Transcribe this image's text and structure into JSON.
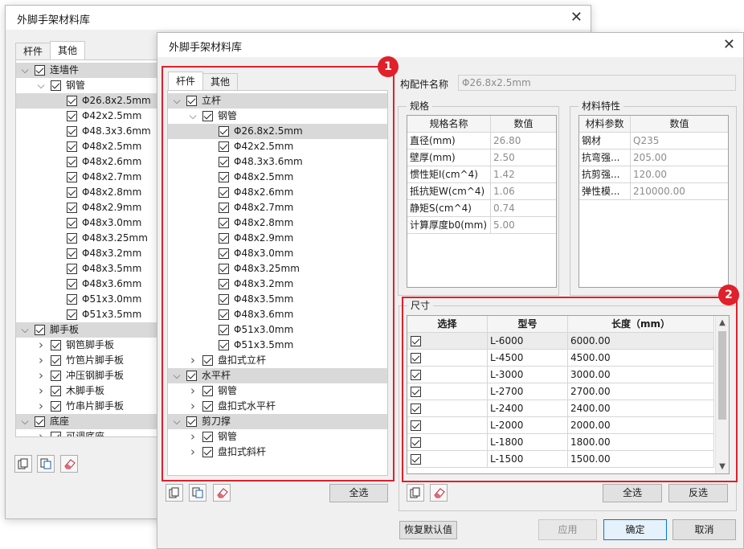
{
  "back_window": {
    "title": "外脚手架材料库",
    "tabs": [
      "杆件",
      "其他"
    ],
    "active_tab": 1,
    "nodes": [
      {
        "level": 0,
        "arrow": "v",
        "label": "连墙件",
        "hl": true
      },
      {
        "level": 1,
        "arrow": "v",
        "label": "钢管",
        "hl": false
      },
      {
        "level": 2,
        "arrow": "",
        "label": "Φ26.8x2.5mm",
        "hl": true
      },
      {
        "level": 2,
        "arrow": "",
        "label": "Φ42x2.5mm",
        "hl": false
      },
      {
        "level": 2,
        "arrow": "",
        "label": "Φ48.3x3.6mm",
        "hl": false
      },
      {
        "level": 2,
        "arrow": "",
        "label": "Φ48x2.5mm",
        "hl": false
      },
      {
        "level": 2,
        "arrow": "",
        "label": "Φ48x2.6mm",
        "hl": false
      },
      {
        "level": 2,
        "arrow": "",
        "label": "Φ48x2.7mm",
        "hl": false
      },
      {
        "level": 2,
        "arrow": "",
        "label": "Φ48x2.8mm",
        "hl": false
      },
      {
        "level": 2,
        "arrow": "",
        "label": "Φ48x2.9mm",
        "hl": false
      },
      {
        "level": 2,
        "arrow": "",
        "label": "Φ48x3.0mm",
        "hl": false
      },
      {
        "level": 2,
        "arrow": "",
        "label": "Φ48x3.25mm",
        "hl": false
      },
      {
        "level": 2,
        "arrow": "",
        "label": "Φ48x3.2mm",
        "hl": false
      },
      {
        "level": 2,
        "arrow": "",
        "label": "Φ48x3.5mm",
        "hl": false
      },
      {
        "level": 2,
        "arrow": "",
        "label": "Φ48x3.6mm",
        "hl": false
      },
      {
        "level": 2,
        "arrow": "",
        "label": "Φ51x3.0mm",
        "hl": false
      },
      {
        "level": 2,
        "arrow": "",
        "label": "Φ51x3.5mm",
        "hl": false
      },
      {
        "level": 0,
        "arrow": "v",
        "label": "脚手板",
        "hl": true
      },
      {
        "level": 1,
        "arrow": ">",
        "label": "钢笆脚手板",
        "hl": false
      },
      {
        "level": 1,
        "arrow": ">",
        "label": "竹笆片脚手板",
        "hl": false
      },
      {
        "level": 1,
        "arrow": ">",
        "label": "冲压钢脚手板",
        "hl": false
      },
      {
        "level": 1,
        "arrow": ">",
        "label": "木脚手板",
        "hl": false
      },
      {
        "level": 1,
        "arrow": ">",
        "label": "竹串片脚手板",
        "hl": false
      },
      {
        "level": 0,
        "arrow": "v",
        "label": "底座",
        "hl": true
      },
      {
        "level": 1,
        "arrow": ">",
        "label": "可调底座",
        "hl": false
      }
    ]
  },
  "front_window": {
    "title": "外脚手架材料库",
    "tabs": [
      "杆件",
      "其他"
    ],
    "active_tab": 0,
    "nodes": [
      {
        "level": 0,
        "arrow": "v",
        "label": "立杆",
        "hl": true
      },
      {
        "level": 1,
        "arrow": "v",
        "label": "钢管",
        "hl": false
      },
      {
        "level": 2,
        "arrow": "",
        "label": "Φ26.8x2.5mm",
        "hl": true
      },
      {
        "level": 2,
        "arrow": "",
        "label": "Φ42x2.5mm",
        "hl": false
      },
      {
        "level": 2,
        "arrow": "",
        "label": "Φ48.3x3.6mm",
        "hl": false
      },
      {
        "level": 2,
        "arrow": "",
        "label": "Φ48x2.5mm",
        "hl": false
      },
      {
        "level": 2,
        "arrow": "",
        "label": "Φ48x2.6mm",
        "hl": false
      },
      {
        "level": 2,
        "arrow": "",
        "label": "Φ48x2.7mm",
        "hl": false
      },
      {
        "level": 2,
        "arrow": "",
        "label": "Φ48x2.8mm",
        "hl": false
      },
      {
        "level": 2,
        "arrow": "",
        "label": "Φ48x2.9mm",
        "hl": false
      },
      {
        "level": 2,
        "arrow": "",
        "label": "Φ48x3.0mm",
        "hl": false
      },
      {
        "level": 2,
        "arrow": "",
        "label": "Φ48x3.25mm",
        "hl": false
      },
      {
        "level": 2,
        "arrow": "",
        "label": "Φ48x3.2mm",
        "hl": false
      },
      {
        "level": 2,
        "arrow": "",
        "label": "Φ48x3.5mm",
        "hl": false
      },
      {
        "level": 2,
        "arrow": "",
        "label": "Φ48x3.6mm",
        "hl": false
      },
      {
        "level": 2,
        "arrow": "",
        "label": "Φ51x3.0mm",
        "hl": false
      },
      {
        "level": 2,
        "arrow": "",
        "label": "Φ51x3.5mm",
        "hl": false
      },
      {
        "level": 1,
        "arrow": ">",
        "label": "盘扣式立杆",
        "hl": false
      },
      {
        "level": 0,
        "arrow": "v",
        "label": "水平杆",
        "hl": true
      },
      {
        "level": 1,
        "arrow": ">",
        "label": "钢管",
        "hl": false
      },
      {
        "level": 1,
        "arrow": ">",
        "label": "盘扣式水平杆",
        "hl": false
      },
      {
        "level": 0,
        "arrow": "v",
        "label": "剪刀撑",
        "hl": true
      },
      {
        "level": 1,
        "arrow": ">",
        "label": "钢管",
        "hl": false
      },
      {
        "level": 1,
        "arrow": ">",
        "label": "盘扣式斜杆",
        "hl": false
      }
    ],
    "select_all_left": "全选",
    "component_name_label": "构配件名称",
    "component_name_value": "Φ26.8x2.5mm",
    "spec": {
      "group_label": "规格",
      "headers": [
        "规格名称",
        "数值"
      ],
      "rows": [
        [
          "直径(mm)",
          "26.80"
        ],
        [
          "壁厚(mm)",
          "2.50"
        ],
        [
          "惯性矩I(cm^4)",
          "1.42"
        ],
        [
          "抵抗矩W(cm^4)",
          "1.06"
        ],
        [
          "静矩S(cm^4)",
          "0.74"
        ],
        [
          "计算厚度b0(mm)",
          "5.00"
        ]
      ]
    },
    "material": {
      "group_label": "材料特性",
      "headers": [
        "材料参数",
        "数值"
      ],
      "rows": [
        [
          "钢材",
          "Q235"
        ],
        [
          "抗弯强...",
          "205.00"
        ],
        [
          "抗剪强...",
          "120.00"
        ],
        [
          "弹性模...",
          "210000.00"
        ]
      ]
    },
    "size": {
      "group_label": "尺寸",
      "headers": [
        "选择",
        "型号",
        "长度（mm）"
      ],
      "rows": [
        [
          "L-6000",
          "6000.00"
        ],
        [
          "L-4500",
          "4500.00"
        ],
        [
          "L-3000",
          "3000.00"
        ],
        [
          "L-2700",
          "2700.00"
        ],
        [
          "L-2400",
          "2400.00"
        ],
        [
          "L-2000",
          "2000.00"
        ],
        [
          "L-1800",
          "1800.00"
        ],
        [
          "L-1500",
          "1500.00"
        ]
      ]
    },
    "select_all_right": "全选",
    "invert_select": "反选",
    "restore_default": "恢复默认值",
    "apply": "应用",
    "ok": "确定",
    "cancel": "取消"
  },
  "badges": [
    "1",
    "2"
  ],
  "colors": {
    "accent_red": "#e0202a",
    "window_bg": "#f0f0f0"
  }
}
